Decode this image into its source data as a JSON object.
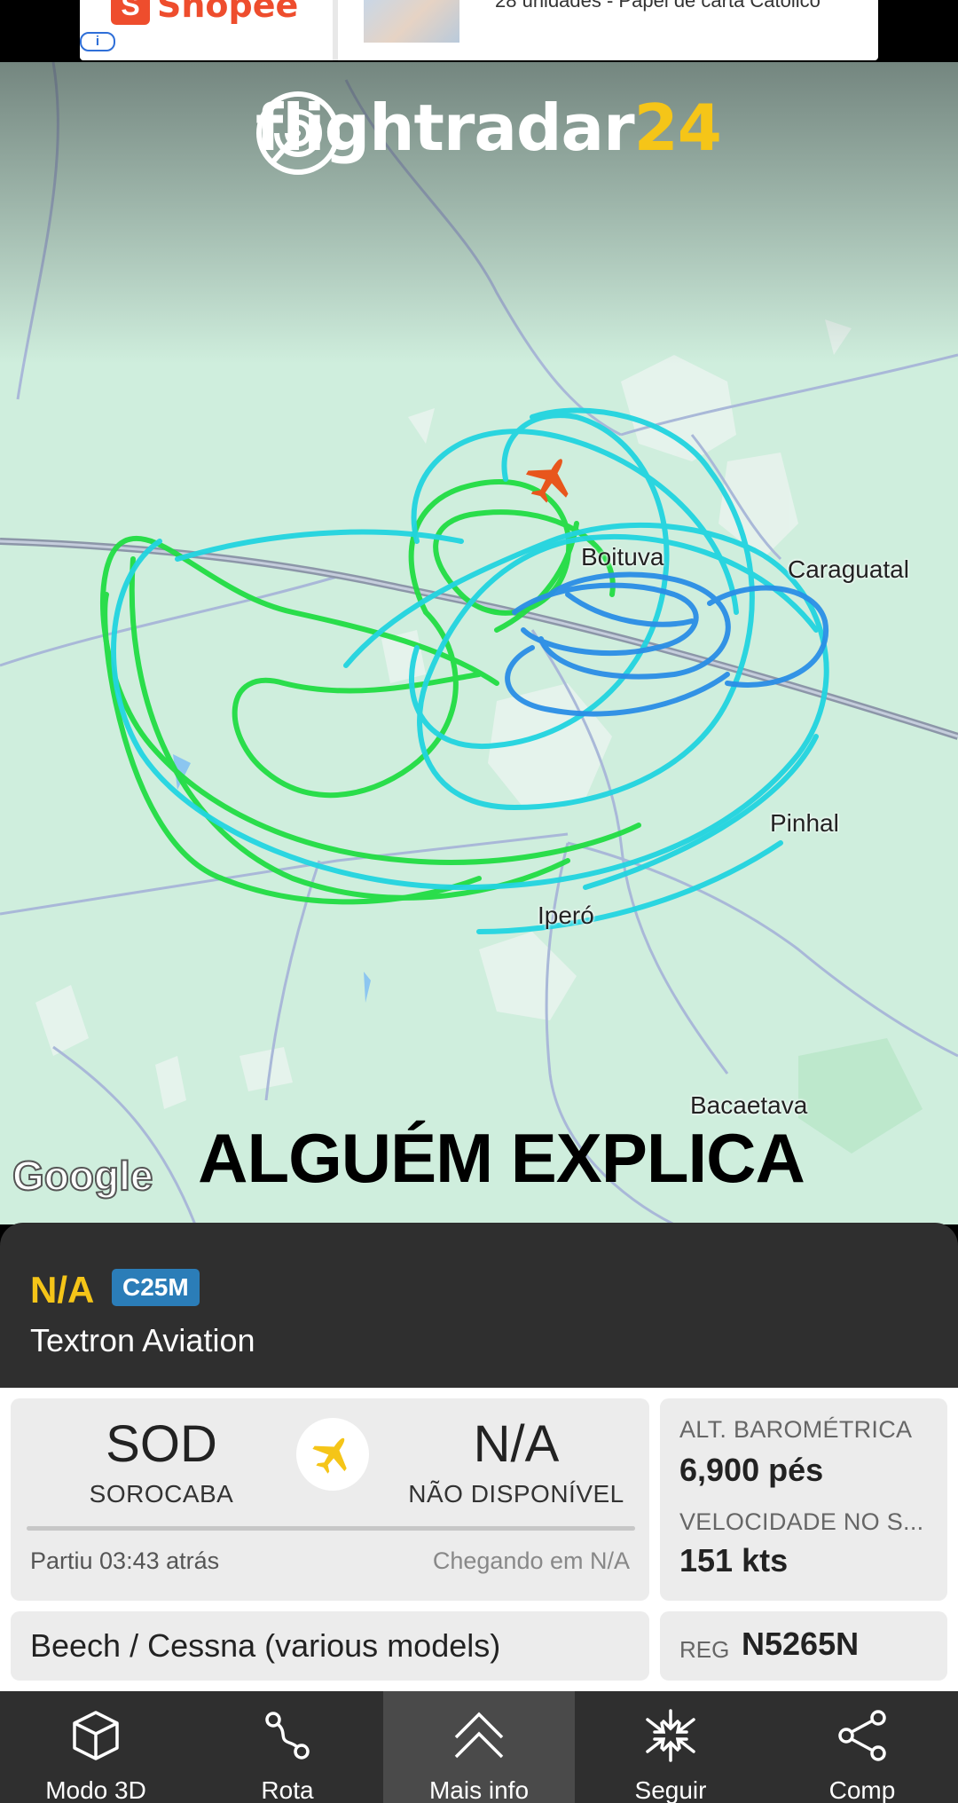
{
  "ad": {
    "brand": "Shopee",
    "brand_icon": "shopee-bag-icon",
    "info_label": "i",
    "text": "28 unidades - Papel de carta Católico"
  },
  "map": {
    "logo_text": "flightradar",
    "logo_number": "24",
    "labels": {
      "boituva": "Boituva",
      "caraguatai": "Caraguatal",
      "pinhal": "Pinhal",
      "ipero": "Iperó",
      "bacaetava": "Bacaetava"
    },
    "caption": "ALGUÉM EXPLICA",
    "google": "Google",
    "colors": {
      "track_green": "#22dd44",
      "track_cyan": "#22d4e0",
      "track_blue": "#2a8ee6",
      "aircraft": "#e8561c"
    }
  },
  "flight": {
    "callsign": "N/A",
    "aircraft_type": "C25M",
    "airline": "Textron Aviation"
  },
  "route": {
    "origin_code": "SOD",
    "origin_name": "SOROCABA",
    "dest_code": "N/A",
    "dest_name": "NÃO DISPONÍVEL",
    "departed": "Partiu 03:43 atrás",
    "arriving": "Chegando em N/A"
  },
  "stats": {
    "altitude_label": "ALT. BAROMÉTRICA",
    "altitude_value": "6,900 pés",
    "speed_label": "VELOCIDADE NO S...",
    "speed_value": "151 kts"
  },
  "aircraft": {
    "model": "Beech / Cessna (various models)",
    "reg_label": "REG",
    "reg_value": "N5265N"
  },
  "nav": {
    "items": [
      {
        "label": "Modo 3D",
        "icon": "cube-icon"
      },
      {
        "label": "Rota",
        "icon": "route-icon"
      },
      {
        "label": "Mais info",
        "icon": "chevron-up-icon"
      },
      {
        "label": "Seguir",
        "icon": "compress-arrows-icon"
      },
      {
        "label": "Comp",
        "icon": "share-icon"
      }
    ]
  }
}
